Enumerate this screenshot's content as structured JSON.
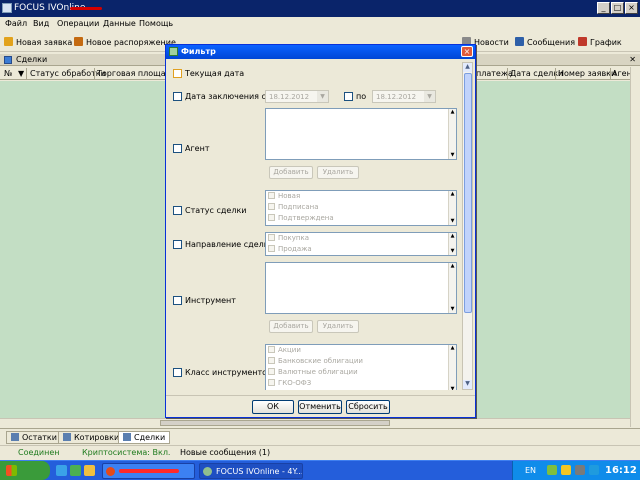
{
  "window": {
    "title": "FOCUS IVOnline - "
  },
  "menu": [
    "Файл",
    "Вид",
    "Операции",
    "Данные",
    "Помощь"
  ],
  "toolbar": {
    "new_order": "Новая заявка",
    "new_instruction": "Новое распоряжение",
    "news": "Новости",
    "messages": "Сообщения",
    "chart": "График"
  },
  "panel": {
    "title": "Сделки"
  },
  "columns": {
    "num": "№",
    "status": "Статус обработки",
    "venue": "Торговая площадк",
    "payment": "платежа",
    "deal_date": "Дата сделки",
    "order_num": "Номер заявки",
    "agent": "Аген"
  },
  "bottom_tabs": [
    "Остатки",
    "Котировки",
    "Сделки"
  ],
  "status": {
    "connected": "Соединен",
    "crypto": "Криптосистема: Вкл.",
    "messages": "Новые сообщения (1)"
  },
  "taskbar": {
    "app_task": "FOCUS IVOnline - 4Y...",
    "lang": "EN",
    "clock": "16:12"
  },
  "dialog": {
    "title": "Фильтр",
    "current_date_label": "Текущая дата",
    "deal_date_label": "Дата заключения с",
    "date_from": "18.12.2012",
    "to_label": "по",
    "date_to": "18.12.2012",
    "agent_label": "Агент",
    "add_label": "Добавить",
    "delete_label": "Удалить",
    "deal_status_label": "Статус сделки",
    "deal_status_items": [
      "Новая",
      "Подписана",
      "Подтверждена"
    ],
    "direction_label": "Направление сделки",
    "direction_items": [
      "Покупка",
      "Продажа"
    ],
    "instrument_label": "Инструмент",
    "instrument_class_label": "Класс инструментов",
    "instrument_class_items": [
      "Акции",
      "Банковские облигации",
      "Валютные облигации",
      "ГКО-ОФЗ"
    ],
    "ok": "ОК",
    "cancel": "Отменить",
    "reset": "Сбросить"
  }
}
